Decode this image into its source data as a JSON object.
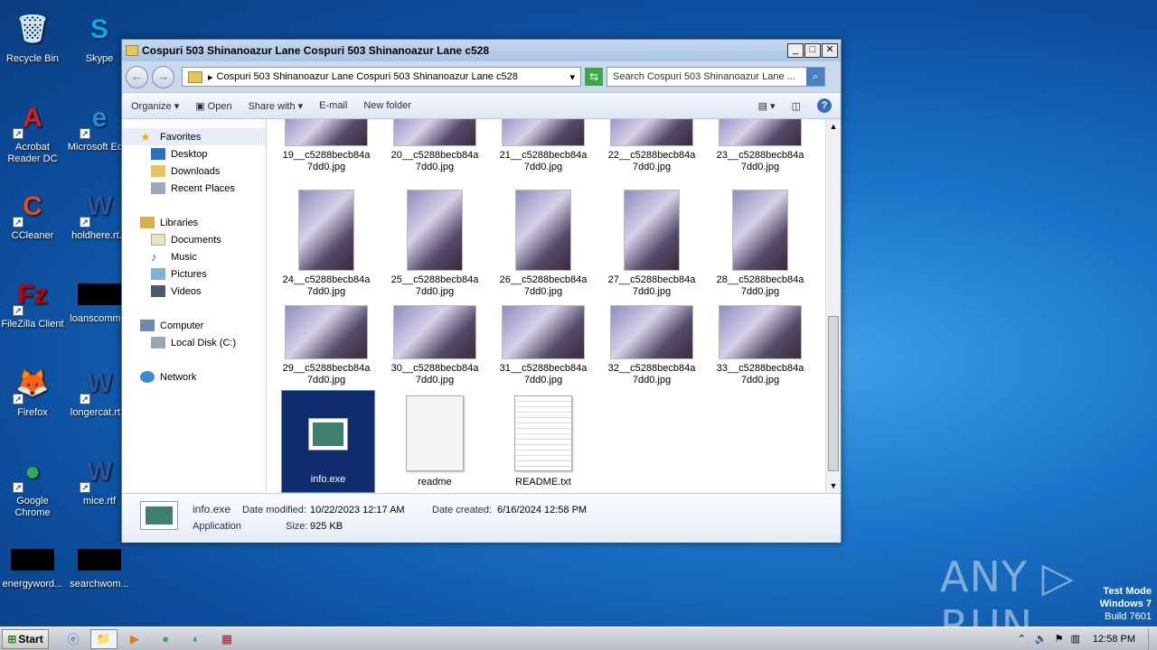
{
  "desktop": {
    "icons": [
      {
        "label": "Recycle Bin",
        "glyph": "🗑",
        "color": "#cfe6f7"
      },
      {
        "label": "Skype",
        "glyph": "S",
        "color": "#00aff0"
      },
      {
        "label": "Acrobat Reader DC",
        "glyph": "A",
        "color": "#d42020"
      },
      {
        "label": "Microsoft Ed...",
        "glyph": "e",
        "color": "#1d8fd8"
      },
      {
        "label": "CCleaner",
        "glyph": "C",
        "color": "#e04a1a"
      },
      {
        "label": "holdhere.rt...",
        "glyph": "W",
        "color": "#2b5797"
      },
      {
        "label": "FileZilla Client",
        "glyph": "Fz",
        "color": "#bf0000"
      },
      {
        "label": "loanscomm...",
        "glyph": "",
        "color": "#000"
      },
      {
        "label": "Firefox",
        "glyph": "🦊",
        "color": "#e66000"
      },
      {
        "label": "longercat.rt...",
        "glyph": "W",
        "color": "#2b5797"
      },
      {
        "label": "Google Chrome",
        "glyph": "●",
        "color": "#34a853"
      },
      {
        "label": "mice.rtf",
        "glyph": "W",
        "color": "#2b5797"
      },
      {
        "label": "energyword...",
        "glyph": "",
        "color": "#000"
      },
      {
        "label": "searchwom...",
        "glyph": "",
        "color": "#000"
      }
    ]
  },
  "window": {
    "title": "Cospuri 503 Shinanoazur Lane Cospuri 503 Shinanoazur Lane c528",
    "address": "Cospuri 503 Shinanoazur Lane Cospuri 503 Shinanoazur Lane c528",
    "search_placeholder": "Search Cospuri 503 Shinanoazur Lane ...",
    "toolbar": {
      "organize": "Organize",
      "open": "Open",
      "share_with": "Share with",
      "email": "E-mail",
      "new_folder": "New folder"
    },
    "nav": {
      "favorites": "Favorites",
      "desktop": "Desktop",
      "downloads": "Downloads",
      "recent": "Recent Places",
      "libraries": "Libraries",
      "documents": "Documents",
      "music": "Music",
      "pictures": "Pictures",
      "videos": "Videos",
      "computer": "Computer",
      "local_disk": "Local Disk (C:)",
      "network": "Network"
    },
    "files": [
      {
        "line1": "19__c5288becb84a",
        "line2": "7dd0.jpg"
      },
      {
        "line1": "20__c5288becb84a",
        "line2": "7dd0.jpg"
      },
      {
        "line1": "21__c5288becb84a",
        "line2": "7dd0.jpg"
      },
      {
        "line1": "22__c5288becb84a",
        "line2": "7dd0.jpg"
      },
      {
        "line1": "23__c5288becb84a",
        "line2": "7dd0.jpg"
      },
      {
        "line1": "24__c5288becb84a",
        "line2": "7dd0.jpg"
      },
      {
        "line1": "25__c5288becb84a",
        "line2": "7dd0.jpg"
      },
      {
        "line1": "26__c5288becb84a",
        "line2": "7dd0.jpg"
      },
      {
        "line1": "27__c5288becb84a",
        "line2": "7dd0.jpg"
      },
      {
        "line1": "28__c5288becb84a",
        "line2": "7dd0.jpg"
      },
      {
        "line1": "29__c5288becb84a",
        "line2": "7dd0.jpg"
      },
      {
        "line1": "30__c5288becb84a",
        "line2": "7dd0.jpg"
      },
      {
        "line1": "31__c5288becb84a",
        "line2": "7dd0.jpg"
      },
      {
        "line1": "32__c5288becb84a",
        "line2": "7dd0.jpg"
      },
      {
        "line1": "33__c5288becb84a",
        "line2": "7dd0.jpg"
      }
    ],
    "special_files": [
      {
        "label": "info.exe"
      },
      {
        "label": "readme"
      },
      {
        "label": "README.txt"
      }
    ],
    "details": {
      "name": "info.exe",
      "type": "Application",
      "modified_label": "Date modified:",
      "modified": "10/22/2023 12:17 AM",
      "created_label": "Date created:",
      "created": "6/16/2024 12:58 PM",
      "size_label": "Size:",
      "size": "925 KB"
    }
  },
  "watermark": {
    "text": "ANY ▷ RUN",
    "line1": "Test Mode",
    "line2": "Windows 7",
    "line3": "Build 7601"
  },
  "taskbar": {
    "start": "Start",
    "clock": "12:58 PM"
  }
}
